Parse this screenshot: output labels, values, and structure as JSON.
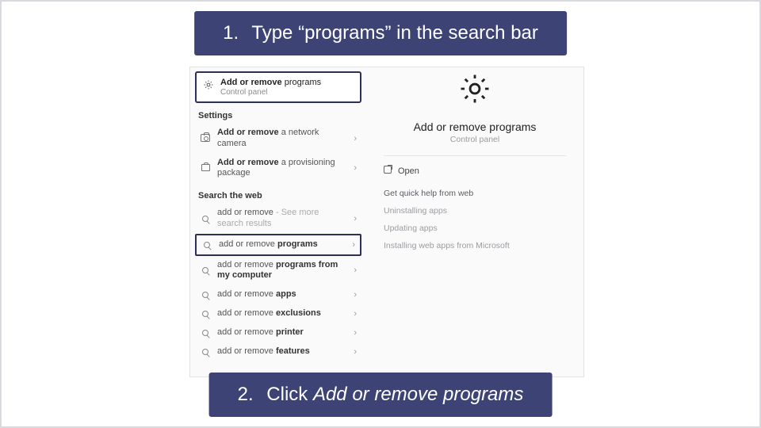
{
  "instructions": {
    "step1_number": "1.",
    "step1_text_prefix": "Type ",
    "step1_text_quoted": "“programs”",
    "step1_text_suffix": " in the search bar",
    "step2_number": "2.",
    "step2_text_prefix": "Click ",
    "step2_text_italic": "Add or remove programs"
  },
  "best_match": {
    "bold": "Add or remove",
    "rest": " programs",
    "subtitle": "Control panel"
  },
  "sections": {
    "settings": "Settings",
    "search_web": "Search the web"
  },
  "settings_results": [
    {
      "bold": "Add or remove",
      "rest": " a network camera",
      "icon": "camera"
    },
    {
      "bold": "Add or remove",
      "rest": " a provisioning package",
      "icon": "box"
    }
  ],
  "web_results": [
    {
      "prefix": "add or remove",
      "bold": "",
      "suffix": " - See more search results",
      "boxed": false
    },
    {
      "prefix": "add or remove ",
      "bold": "programs",
      "suffix": "",
      "boxed": true
    },
    {
      "prefix": "add or remove ",
      "bold": "programs from my computer",
      "suffix": "",
      "boxed": false
    },
    {
      "prefix": "add or remove ",
      "bold": "apps",
      "suffix": "",
      "boxed": false
    },
    {
      "prefix": "add or remove ",
      "bold": "exclusions",
      "suffix": "",
      "boxed": false
    },
    {
      "prefix": "add or remove ",
      "bold": "printer",
      "suffix": "",
      "boxed": false
    },
    {
      "prefix": "add or remove ",
      "bold": "features",
      "suffix": "",
      "boxed": false
    }
  ],
  "detail": {
    "title": "Add or remove programs",
    "subtitle": "Control panel",
    "open": "Open",
    "quick_help": "Get quick help from web",
    "links": [
      "Uninstalling apps",
      "Updating apps",
      "Installing web apps from Microsoft"
    ]
  }
}
